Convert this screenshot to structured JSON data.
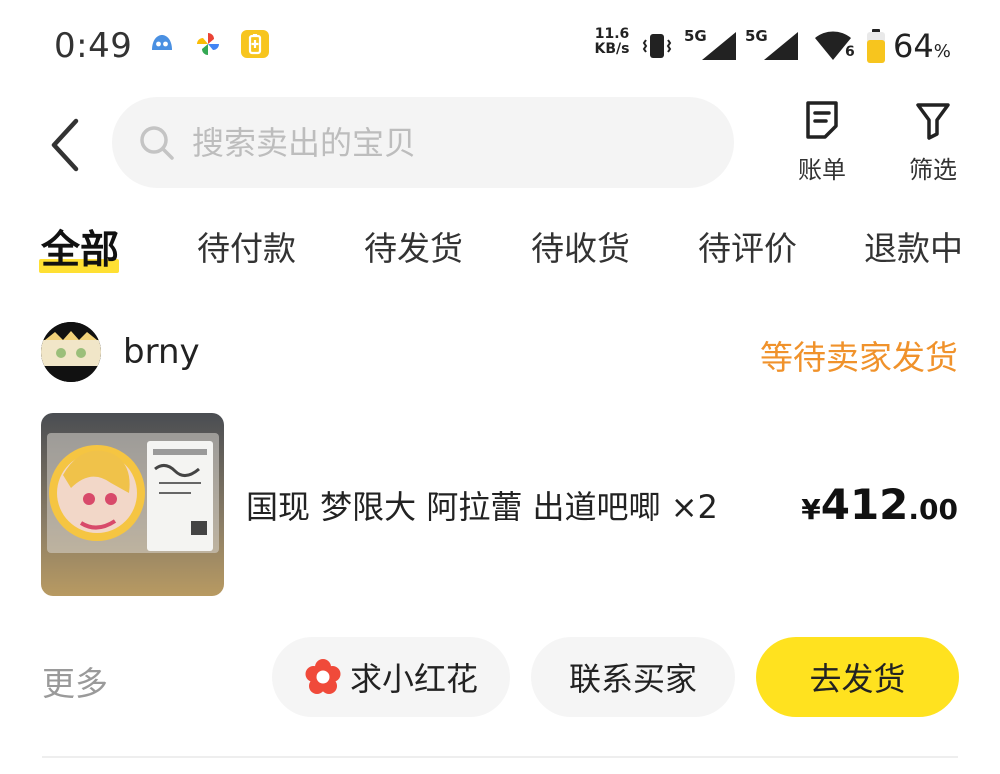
{
  "status_bar": {
    "time": "0:49",
    "net_speed_value": "11.6",
    "net_speed_unit": "KB/s",
    "signal_1_label": "5G",
    "signal_2_label": "5G",
    "wifi_badge": "6",
    "battery_percent": "64",
    "battery_unit": "%",
    "icons": [
      "notification-bird-icon",
      "pinwheel-icon",
      "battery-saver-icon",
      "vibrate-icon",
      "signal-icon",
      "wifi-icon",
      "battery-icon"
    ]
  },
  "header": {
    "search_placeholder": "搜索卖出的宝贝",
    "bill_label": "账单",
    "filter_label": "筛选"
  },
  "tabs": [
    {
      "label": "全部",
      "active": true
    },
    {
      "label": "待付款",
      "active": false
    },
    {
      "label": "待发货",
      "active": false
    },
    {
      "label": "待收货",
      "active": false
    },
    {
      "label": "待评价",
      "active": false
    },
    {
      "label": "退款中",
      "active": false
    }
  ],
  "order": {
    "buyer_name": "brny",
    "status": "等待卖家发货",
    "item_title": "国现 梦限大 阿拉蕾 出道吧唧 ×2",
    "price_currency": "¥",
    "price_integer": "412",
    "price_decimal": ".00",
    "more_label": "更多",
    "actions": {
      "flower_label": "求小红花",
      "contact_label": "联系买家",
      "ship_label": "去发货"
    }
  },
  "colors": {
    "accent_yellow": "#ffe21f",
    "status_orange": "#f0922b",
    "flower_red": "#f04a3a"
  }
}
